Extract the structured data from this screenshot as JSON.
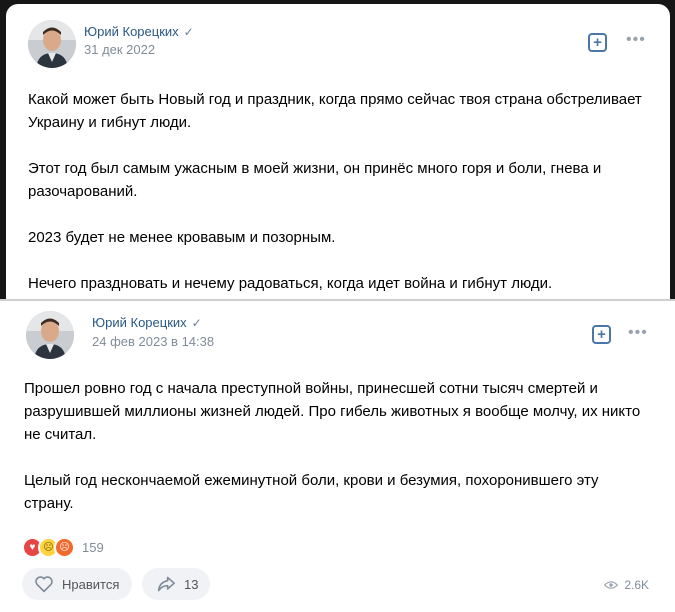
{
  "post1": {
    "author": "Юрий Корецких",
    "date": "31 дек 2022",
    "paragraphs": [
      "Какой может быть Новый год и праздник, когда прямо сейчас твоя страна обстреливает Украину и гибнут люди.",
      "Этот год был самым ужасным в моей жизни, он принёс много горя и боли, гнева и разочарований.",
      "2023 будет не менее кровавым и позорным.",
      "Нечего праздновать и нечему радоваться, когда идет война и гибнут люди."
    ]
  },
  "post2": {
    "author": "Юрий Корецких",
    "date": "24 фев 2023 в 14:38",
    "paragraphs": [
      "Прошел ровно год с начала преступной войны, принесшей сотни тысяч смертей и разрушившей миллионы жизней людей. Про гибель животных я вообще молчу, их никто не считал.",
      "Целый год нескончаемой ежеминутной боли, крови и безумия, похоронившего эту страну."
    ],
    "reactions_count": "159",
    "like_label": "Нравится",
    "shares_count": "13",
    "views_count": "2.6K"
  },
  "colors": {
    "link": "#2a5885",
    "accent": "#4a76a8",
    "muted": "#818c99",
    "pill_bg": "#f0f2f5"
  },
  "icons": [
    "verified-check-icon",
    "add-post-icon",
    "more-dots-icon",
    "heart-icon",
    "share-arrow-icon",
    "eye-icon"
  ]
}
